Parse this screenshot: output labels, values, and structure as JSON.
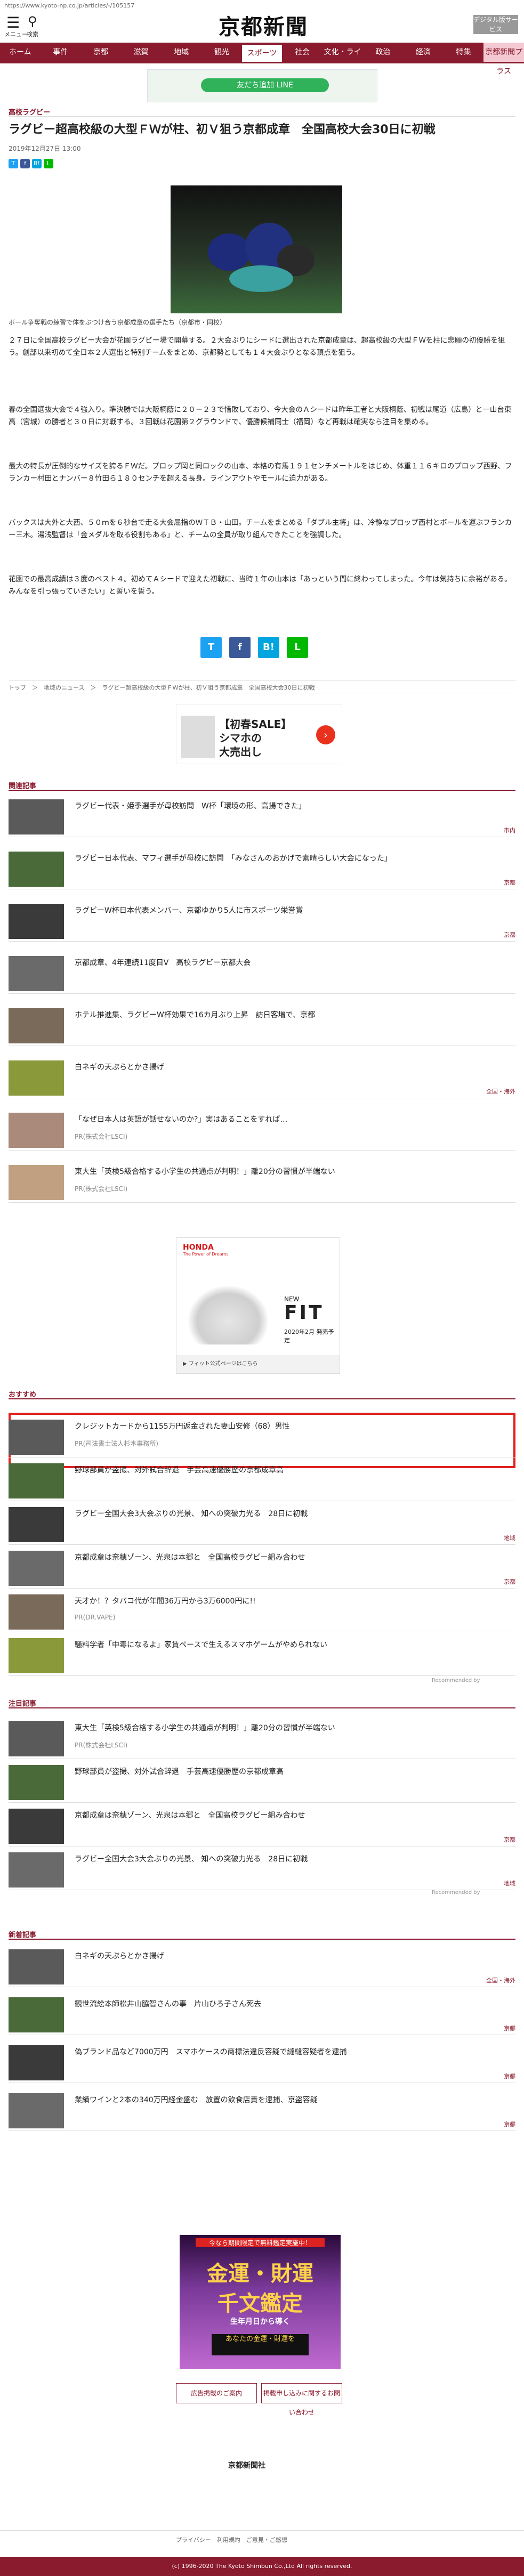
{
  "header": {
    "url": "https://www.kyoto-np.co.jp/articles/-/105157",
    "menu_label": "メニュー",
    "search_label": "検索",
    "logo": "京都新聞",
    "ad_button": "デジタル版サービス"
  },
  "nav": [
    "ホーム",
    "事件",
    "京都",
    "滋賀",
    "地域",
    "観光",
    "スポーツ",
    "社会",
    "文化・ライフ",
    "政治",
    "経済",
    "特集",
    "京都新聞プラス"
  ],
  "ad_strip": "友だち追加 LINE",
  "article": {
    "section": "高校ラグビー",
    "title": "ラグビー超高校級の大型ＦＷが柱、初Ｖ狙う京都成章　全国高校大会30日に初戦",
    "date": "2019年12月27日 13:00",
    "caption": "ボール争奪戦の練習で体をぶつけ合う京都成章の選手たち（京都市・同校）",
    "paragraphs": [
      "２７日に全国高校ラグビー大会が花園ラグビー場で開幕する。２大会ぶりにシードに選出された京都成章は、超高校級の大型ＦＷを柱に悲願の初優勝を狙う。創部以来初めて全日本２人選出と特別チームをまとめ、京都勢としても１４大会ぶりとなる頂点を狙う。",
      "春の全国選抜大会で４強入り。準決勝では大阪桐蔭に２０－２３で惜敗しており、今大会のＡシードは昨年王者と大阪桐蔭、初戦は尾道（広島）と一山台東高（宮城）の勝者と３０日に対戦する。３回戦は花園第２グラウンドで、優勝候補同士（福岡）など再戦は確実なら注目を集める。",
      "最大の特長が圧倒的なサイズを誇るＦＷだ。プロップ岡と同ロックの山本、本格の有馬１９１センチメートルをはじめ、体重１１６キロのプロップ西野、フランカー村田とナンバー８竹田ら１８０センチを超える長身。ラインアウトやモールに迫力がある。",
      "バックスは大外と大西、５０ｍを６秒台で走る大会屈指のＷＴＢ・山田。チームをまとめる「ダブル主将」は、冷静なプロップ西村とボールを運ぶフランカー三木。湯浅監督は「金メダルを取る役割もある」と、チームの全員が取り組んできたことを強調した。",
      "花園での最高成績は３度のベスト４。初めてＡシードで迎えた初戦に、当時１年の山本は「あっという間に終わってしまった。今年は気持ちに余裕がある。みんなを引っ張っていきたい」と誓いを誓う。"
    ],
    "share_small": [
      "T",
      "f",
      "B!",
      "L"
    ],
    "share_big": [
      "T",
      "f",
      "B!",
      "L"
    ],
    "breadcrumb": "トップ　＞　地域のニュース　＞　ラグビー超高校級の大型ＦＷが柱、初Ｖ狙う京都成章　全国高校大会30日に初戦"
  },
  "sale": {
    "line1": "【初春SALE】",
    "line2": "シマホの",
    "line3": "大売出し"
  },
  "related": {
    "heading": "関連記事",
    "items": [
      {
        "title": "ラグビー代表・姫季選手が母校訪問　W杯「環境の形、高揚できた」",
        "cat": "市内"
      },
      {
        "title": "ラグビー日本代表、マフィ選手が母校に訪問　「みなさんのおかげで素晴らしい大会になった」",
        "cat": "京都"
      },
      {
        "title": "ラグビーW杯日本代表メンバー、京都ゆかり5人に市スポーツ栄誉賞",
        "cat": "京都"
      },
      {
        "title": "京都成章、4年連続11度目V　高校ラグビー京都大会",
        "cat": ""
      },
      {
        "title": "ホテル推進集、ラグビーW杯効果で16カ月ぶり上昇　訪日客増で、京都",
        "cat": ""
      },
      {
        "title": "白ネギの天ぷらとかき揚げ",
        "cat": "全国・海外"
      },
      {
        "title": "「なぜ日本人は英語が話せないのか?」実はあることをすれば…",
        "pr": "PR(株式会社LSCI)"
      },
      {
        "title": "東大生「英検5級合格する小学生の共通点が判明！」離20分の習慣が半端ない",
        "pr": "PR(株式会社LSCI)"
      }
    ]
  },
  "fit": {
    "brand": "HONDA",
    "tagline": "The Power of Dreams",
    "new": "NEW",
    "model": "FIT",
    "date": "2020年2月 発売予定",
    "footer": "▶ フィット公式ページはこちら"
  },
  "osusume": {
    "heading": "おすすめ",
    "items": [
      {
        "title": "クレジットカードから1155万円返金された妻山安修（68）男性",
        "pr": "PR(司法書士法人杉本事務所)"
      },
      {
        "title": "野球部員が盗撮、対外試合辞退　手芸高速優勝歴の京都成章高",
        "cat": ""
      },
      {
        "title": "ラグビー全国大会3大会ぶりの光景、 知への突破力光る　28日に初戦",
        "cat": "地域"
      },
      {
        "title": "京都成章は奈穂ゾーン、光泉は本郷と　全国高校ラグビー組み合わせ",
        "cat": "京都"
      },
      {
        "title": "天才か！？タバコ代が年間36万円から3万6000円に!!",
        "pr": "PR(DR.VAPE)"
      },
      {
        "title": "騒料学者「中毒になるよ」家賃ペースで生えるスマホゲームがやめられない",
        "cat": ""
      }
    ],
    "recommended_by": "Recommended by"
  },
  "popular": {
    "heading": "注目記事",
    "items": [
      {
        "title": "東大生「英検5級合格する小学生の共通点が判明！」離20分の習慣が半端ない",
        "pr": "PR(株式会社LSCI)"
      },
      {
        "title": "野球部員が盗撮、対外試合辞退　手芸高速優勝歴の京都成章高",
        "cat": ""
      },
      {
        "title": "京都成章は奈穂ゾーン、光泉は本郷と　全国高校ラグビー組み合わせ",
        "cat": "京都"
      },
      {
        "title": "ラグビー全国大会3大会ぶりの光景、 知への突破力光る　28日に初戦",
        "cat": "地域"
      }
    ],
    "recommended_by": "Recommended by"
  },
  "latest": {
    "heading": "新着記事",
    "items": [
      {
        "title": "白ネギの天ぷらとかき揚げ",
        "cat": "全国・海外"
      },
      {
        "title": "観世流絵本師松井山脇智さんの事　片山ひろ子さん死去",
        "cat": "京都"
      },
      {
        "title": "偽ブランド品など7000万円　スマホケースの商標法違反容疑で縫縫容疑者を逮捕",
        "cat": "京都"
      },
      {
        "title": "業績ワインと2本の340万円経金盛む　放置の飲食店責を逮捕、京盗容疑",
        "cat": "京都"
      }
    ]
  },
  "kantei": {
    "top": "今なら期間限定で無料鑑定実施中！",
    "l1": "金運・財運",
    "l2": "千文鑑定",
    "l3": "生年月日から導く",
    "l4": "あなたの金運・財運を"
  },
  "buttons": [
    "広告掲載のご案内",
    "掲載申し込みに関するお問い合わせ"
  ],
  "footer": {
    "logo": "京都新聞社",
    "nav": "プライバシー　利用規約　ご意見・ご感想",
    "copyright": "(c) 1996-2020 The Kyoto Shimbun Co.,Ltd All rights reserved."
  },
  "colors": {
    "brand": "#8a1a2d",
    "twitter": "#1da1f2",
    "facebook": "#3b5998",
    "hatena": "#00a4de",
    "line": "#00b900",
    "highlight": "#e02020"
  }
}
